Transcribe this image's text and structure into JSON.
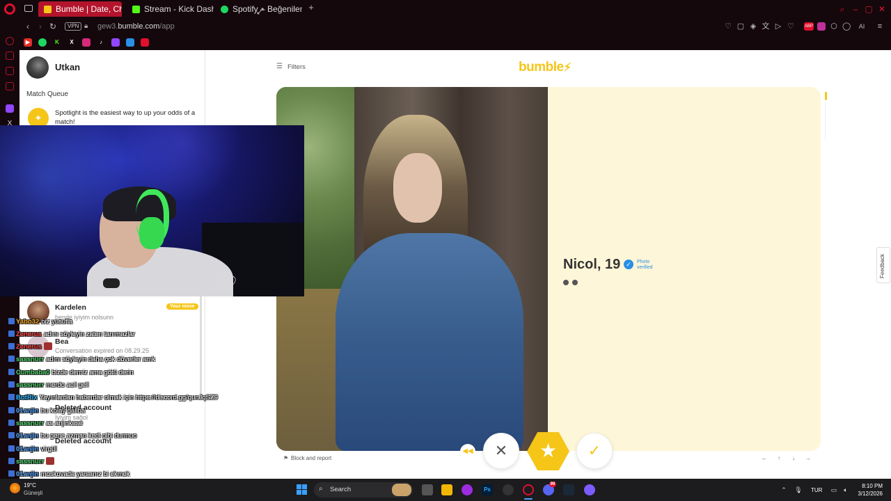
{
  "browser": {
    "tabs": [
      {
        "label": "Bumble | Date, Chat, Meet",
        "active": true,
        "color": "#f5c518"
      },
      {
        "label": "Stream - Kick Dashboard",
        "active": false,
        "color": "#53fc18"
      },
      {
        "label": "Spotify – Beğenilen Şarkıla",
        "active": false,
        "color": "#1ed760"
      }
    ],
    "vpn_label": "VPN",
    "url_prefix": "gew3.",
    "url_domain": "bumble.com",
    "url_path": "/app",
    "ai_label": "AI",
    "ext_badge": "ABP"
  },
  "sidebar": {
    "user_name": "Utkan",
    "match_queue": "Match Queue",
    "spotlight_text": "Spotlight is the easiest way to up your odds of a match!",
    "conversations": [
      {
        "name": "Kardelen",
        "subtitle": "bende iyiyim nolsunn",
        "badge": "Your move"
      },
      {
        "name": "Bea",
        "subtitle": "Conversation expired on 08.29.25"
      },
      {
        "name": "Deleted account",
        "subtitle": "İyiyim sağol"
      },
      {
        "name": "Deleted account",
        "subtitle": ""
      }
    ]
  },
  "chat": [
    {
      "user": "Yabo32",
      "msg": "biz yusufla",
      "color": "#f5a623"
    },
    {
      "user": "Zenerus",
      "msg": "adını söyleyin zaten tanımazlar",
      "color": "#ff4040"
    },
    {
      "user": "Zenerus",
      "msg": "",
      "color": "#ff4040"
    },
    {
      "user": "sassnurr",
      "msg": "adını söyleyin daha çok döverler amk",
      "color": "#4ed36b"
    },
    {
      "user": "Cumbaba0",
      "msg": "bizde derniz ama götü derin",
      "color": "#4ed36b"
    },
    {
      "user": "sassnurr",
      "msg": "merdo acil gell",
      "color": "#4ed36b"
    },
    {
      "user": "BotRix",
      "msg": "Yayınlardan haberdar olmak için https://discord.gg/qunJqSZ9",
      "color": "#2db9ff"
    },
    {
      "user": "01anjin",
      "msg": "bu kolay galiba",
      "color": "#5aa8ff"
    },
    {
      "user": "sassnurr",
      "msg": "as anjinkese",
      "color": "#4ed36b"
    },
    {
      "user": "01anjin",
      "msg": "bu gene azman kedi gibi durmuo",
      "color": "#5aa8ff"
    },
    {
      "user": "01anjin",
      "msg": "virgül",
      "color": "#5aa8ff"
    },
    {
      "user": "sassnurr",
      "msg": "",
      "color": "#4ed36b"
    },
    {
      "user": "01anjin",
      "msg": "moskovada yarsanız bi ekmek",
      "color": "#5aa8ff"
    }
  ],
  "main": {
    "filters_label": "Filters",
    "logo": "bumble",
    "profile_name": "Nicol, 19",
    "verified_label": "Photo verified",
    "block_label": "Block and report",
    "feedback_label": "Feedback"
  },
  "taskbar": {
    "temp": "19°C",
    "weather": "Güneşli",
    "search_label": "Search",
    "language": "TUR",
    "time": "8:10 PM",
    "date": "3/12/2026",
    "discord_badge": "99"
  }
}
